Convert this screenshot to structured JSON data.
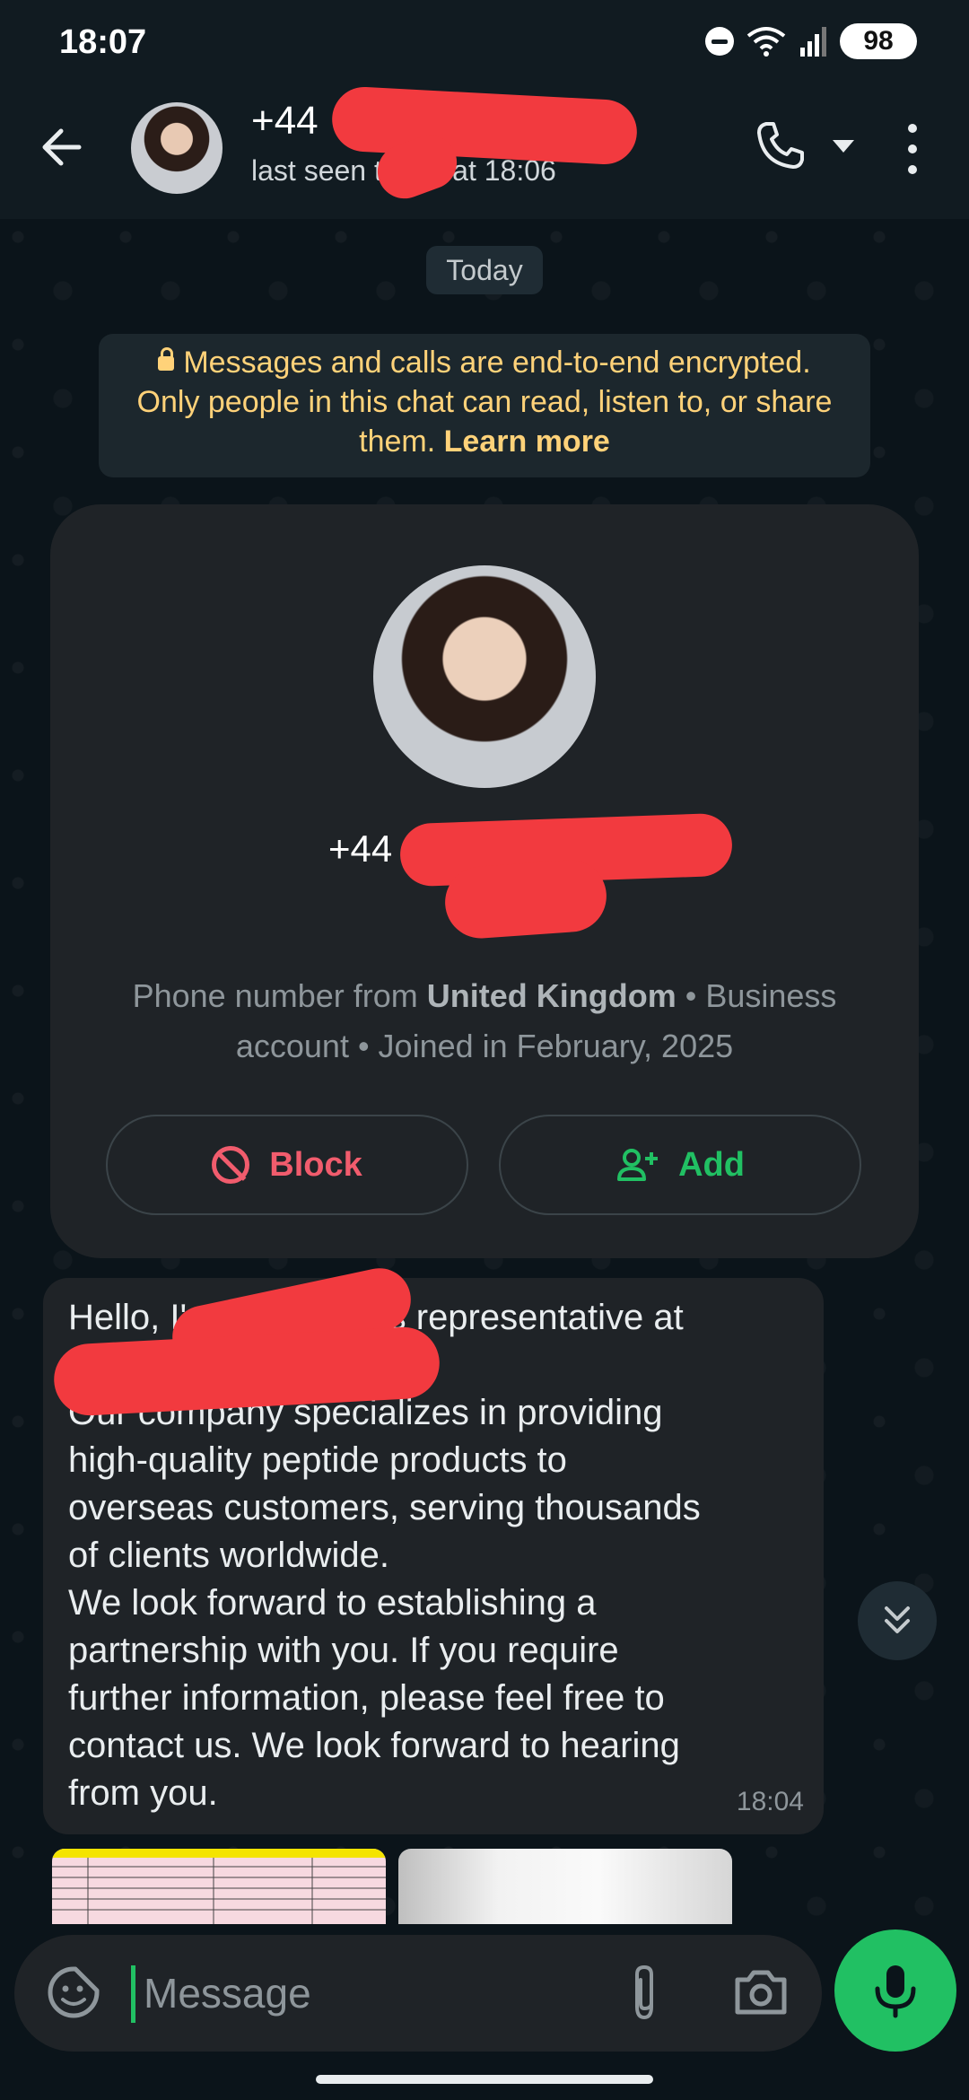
{
  "status_bar": {
    "time": "18:07",
    "battery": "98",
    "icons": [
      "dnd-icon",
      "wifi-icon",
      "signal-icon",
      "battery-icon"
    ]
  },
  "header": {
    "contact_name": "+44",
    "contact_status": "last seen today at 18:06",
    "icons": [
      "back-arrow-icon",
      "phone-icon",
      "chevron-down-icon",
      "more-vert-icon"
    ]
  },
  "chat": {
    "date_label": "Today",
    "encryption": {
      "text": "Messages and calls are end-to-end encrypted. Only people in this chat can read, listen to, or share them.",
      "link": "Learn more"
    },
    "profile_card": {
      "number": "+44",
      "info_prefix": "Phone number from ",
      "country": "United Kingdom",
      "info_suffix": " • Business account • Joined in February, 2025",
      "block_label": "Block",
      "add_label": "Add"
    },
    "message": {
      "line1": "Hello, I'm U",
      "line1_end": "sales representative at",
      "body": "Our company specializes in providing\nhigh-quality peptide products to\noverseas customers, serving thousands\nof clients worldwide.\nWe look forward to establishing a\npartnership with you. If you require\nfurther information, please feel free to\ncontact us. We look forward to hearing\nfrom you.",
      "time": "18:04"
    }
  },
  "input": {
    "placeholder": "Message"
  },
  "colors": {
    "accent": "#21c063",
    "background": "#0b141a",
    "bubble": "#1f2327",
    "danger": "#f15c6d",
    "notice": "#ffd279",
    "redaction": "#f23a3f"
  }
}
